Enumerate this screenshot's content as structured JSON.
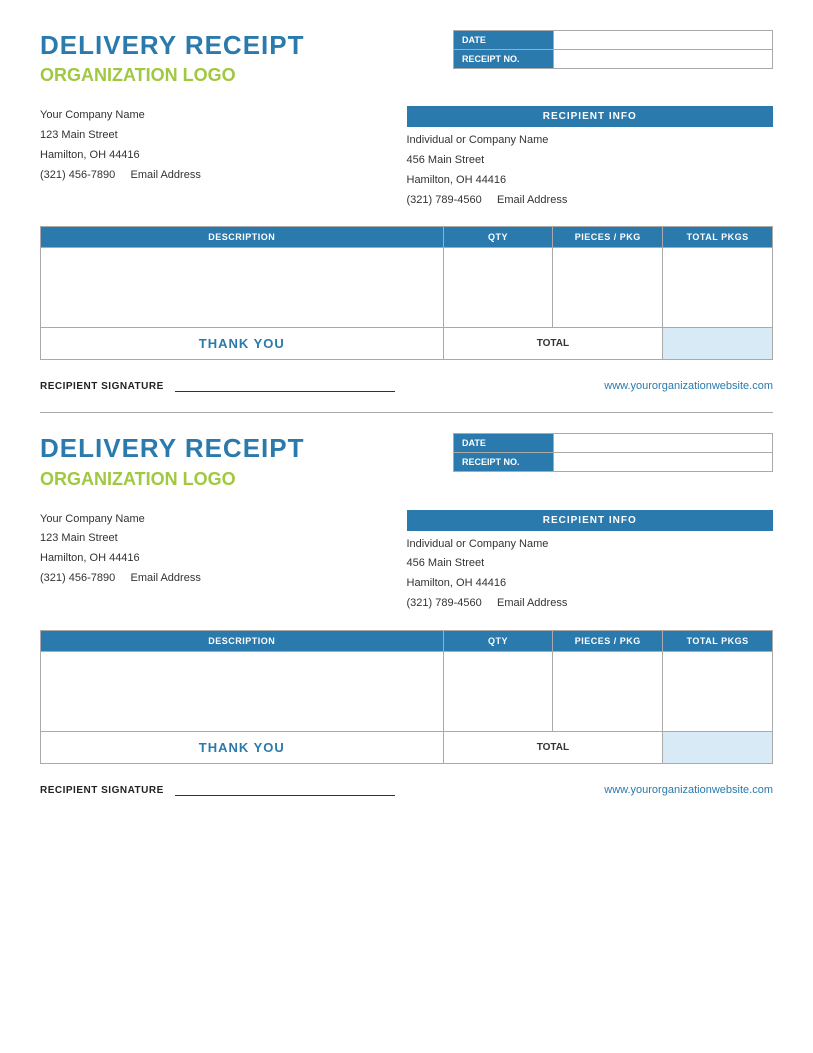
{
  "receipt1": {
    "title": "DELIVERY RECEIPT",
    "org_logo": "ORGANIZATION LOGO",
    "date_label": "DATE",
    "receipt_no_label": "RECEIPT NO.",
    "date_value": "",
    "receipt_no_value": "",
    "sender": {
      "company": "Your Company Name",
      "address1": "123 Main Street",
      "address2": "Hamilton, OH  44416",
      "phone": "(321) 456-7890",
      "email_label": "Email Address"
    },
    "recipient_info_header": "RECIPIENT INFO",
    "recipient": {
      "company": "Individual or Company Name",
      "address1": "456 Main Street",
      "address2": "Hamilton, OH  44416",
      "phone": "(321) 789-4560",
      "email_label": "Email Address"
    },
    "table": {
      "col_desc": "DESCRIPTION",
      "col_qty": "QTY",
      "col_pieces": "PIECES / PKG",
      "col_total": "TOTAL PKGS",
      "thank_you": "THANK YOU",
      "total_label": "TOTAL"
    },
    "signature_label": "RECIPIENT SIGNATURE",
    "website": "www.yourorganizationwebsite.com"
  },
  "receipt2": {
    "title": "DELIVERY RECEIPT",
    "org_logo": "ORGANIZATION LOGO",
    "date_label": "DATE",
    "receipt_no_label": "RECEIPT NO.",
    "date_value": "",
    "receipt_no_value": "",
    "sender": {
      "company": "Your Company Name",
      "address1": "123 Main Street",
      "address2": "Hamilton, OH  44416",
      "phone": "(321) 456-7890",
      "email_label": "Email Address"
    },
    "recipient_info_header": "RECIPIENT INFO",
    "recipient": {
      "company": "Individual or Company Name",
      "address1": "456 Main Street",
      "address2": "Hamilton, OH  44416",
      "phone": "(321) 789-4560",
      "email_label": "Email Address"
    },
    "table": {
      "col_desc": "DESCRIPTION",
      "col_qty": "QTY",
      "col_pieces": "PIECES / PKG",
      "col_total": "TOTAL PKGS",
      "thank_you": "THANK YOU",
      "total_label": "TOTAL"
    },
    "signature_label": "RECIPIENT SIGNATURE",
    "website": "www.yourorganizationwebsite.com"
  }
}
